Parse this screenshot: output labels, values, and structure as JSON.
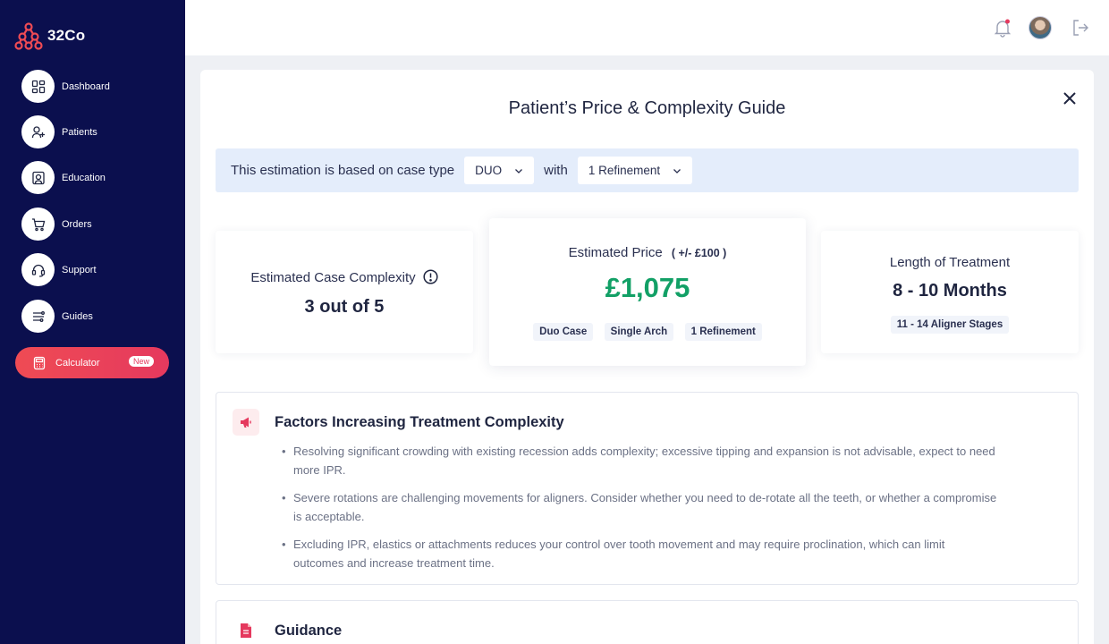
{
  "brand": {
    "name": "32Co",
    "logo_icon": "molecule-logo-icon",
    "color": "#ef4b54"
  },
  "sidebar": {
    "items": [
      {
        "label": "Dashboard",
        "icon": "dashboard-icon"
      },
      {
        "label": "Patients",
        "icon": "patients-icon"
      },
      {
        "label": "Education",
        "icon": "education-icon"
      },
      {
        "label": "Orders",
        "icon": "cart-icon"
      },
      {
        "label": "Support",
        "icon": "headset-icon"
      },
      {
        "label": "Guides",
        "icon": "guides-icon"
      }
    ],
    "calculator": {
      "label": "Calculator",
      "badge": "New",
      "icon": "calculator-icon",
      "active": true
    }
  },
  "topbar": {
    "icons": [
      "bell-icon",
      "avatar",
      "logout-icon"
    ],
    "notification_dot": true
  },
  "modal": {
    "title": "Patient’s Price & Complexity Guide",
    "estimation": {
      "prefix": "This estimation is based on case type",
      "case_type": "DUO",
      "connector": "with",
      "refinement": "1 Refinement"
    },
    "complexity": {
      "label": "Estimated Case Complexity",
      "value": "3 out of 5",
      "level": 3,
      "max": 5
    },
    "price": {
      "label": "Estimated Price",
      "range_note": "( +/- £100 )",
      "value": "£1,075",
      "tags": [
        "Duo Case",
        "Single Arch",
        "1 Refinement"
      ]
    },
    "length": {
      "label": "Length of Treatment",
      "value": "8 - 10 Months",
      "stages": "11 - 14 Aligner Stages"
    },
    "factors": {
      "title": "Factors Increasing Treatment Complexity",
      "icon": "megaphone-icon",
      "bullets": [
        "Resolving significant crowding with existing recession adds complexity; excessive tipping and expansion is not advisable, expect to need more IPR.",
        "Severe rotations are challenging movements for aligners. Consider whether you need to de-rotate all the teeth, or whether a compromise is acceptable.",
        "Excluding IPR, elastics or attachments reduces your control over tooth movement and may require proclination, which can limit outcomes and increase treatment time."
      ]
    },
    "guidance": {
      "title": "Guidance",
      "icon": "document-icon"
    }
  },
  "colors": {
    "sidebar_bg": "#0b0f4e",
    "accent": "#e5395e",
    "price_green": "#12a066",
    "estimation_bg": "#e4edfb"
  }
}
